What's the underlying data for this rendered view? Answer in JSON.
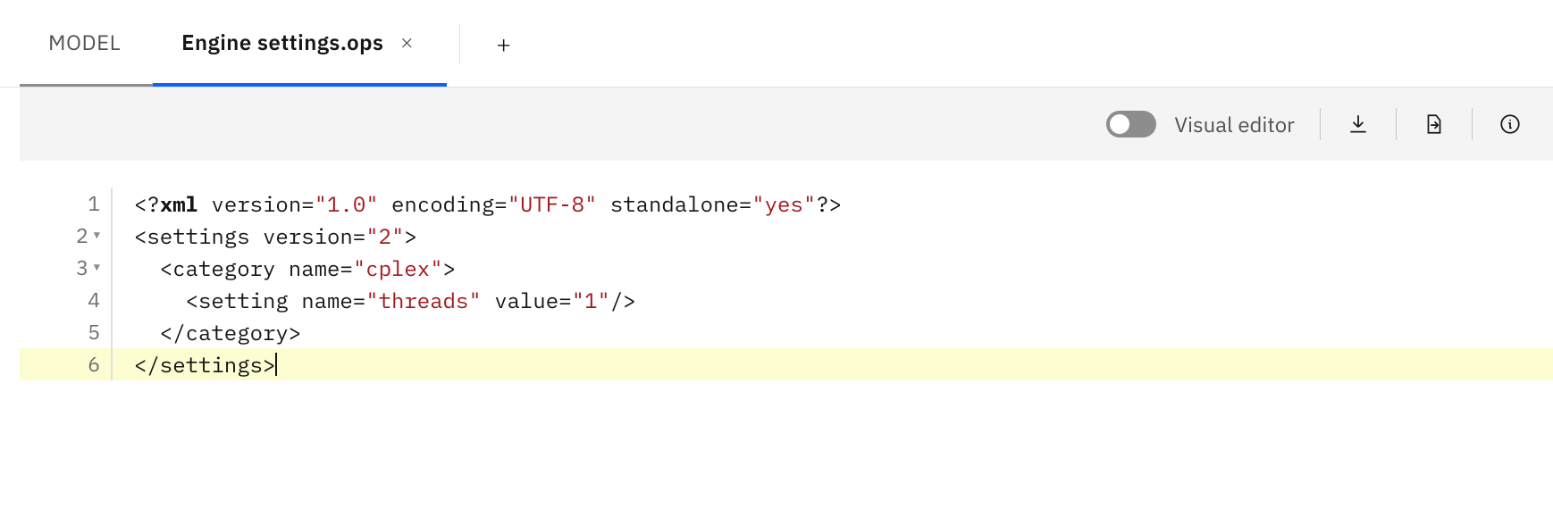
{
  "tabs": {
    "inactive": "MODEL",
    "active": "Engine settings.ops"
  },
  "toolbar": {
    "visual_editor": "Visual editor"
  },
  "gutter": [
    "1",
    "2",
    "3",
    "4",
    "5",
    "6"
  ],
  "code": {
    "l1": {
      "a": "<?",
      "b": "xml",
      "c": " version=",
      "d": "\"1.0\"",
      "e": " encoding=",
      "f": "\"UTF-8\"",
      "g": " standalone=",
      "h": "\"yes\"",
      "i": "?>"
    },
    "l2": {
      "a": "<settings version=",
      "b": "\"2\"",
      "c": ">"
    },
    "l3": {
      "a": "  <category name=",
      "b": "\"cplex\"",
      "c": ">"
    },
    "l4": {
      "a": "    <setting name=",
      "b": "\"threads\"",
      "c": " value=",
      "d": "\"1\"",
      "e": "/>"
    },
    "l5": {
      "a": "  </category>"
    },
    "l6": {
      "a": "</settings>"
    }
  }
}
